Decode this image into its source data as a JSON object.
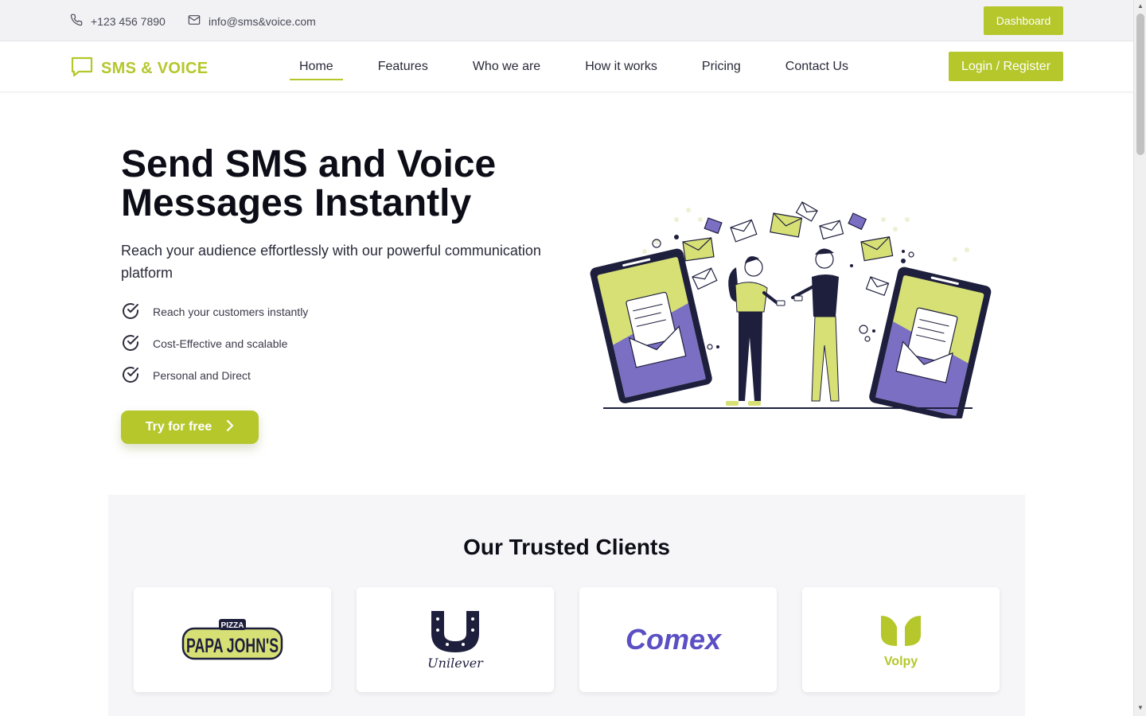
{
  "topbar": {
    "phone": "+123 456 7890",
    "email": "info@sms&voice.com",
    "dashboard_label": "Dashboard"
  },
  "nav": {
    "brand": "SMS & VOICE",
    "links": [
      "Home",
      "Features",
      "Who we are",
      "How it works",
      "Pricing",
      "Contact Us"
    ],
    "active": "Home",
    "login_label": "Login / Register"
  },
  "hero": {
    "title_line1": "Send SMS and Voice",
    "title_line2": "Messages Instantly",
    "subtitle": "Reach your audience effortlessly with our powerful communication platform",
    "features": [
      "Reach your customers instantly",
      "Cost-Effective and scalable",
      "Personal and Direct"
    ],
    "cta_label": "Try for free"
  },
  "clients": {
    "title": "Our Trusted Clients",
    "logos": [
      "PAPA JOHN'S",
      "Unilever",
      "Comex",
      "Volpy"
    ],
    "papa_small": "PIZZA"
  },
  "colors": {
    "accent": "#b5c72b",
    "purple": "#7b6fc4",
    "dark": "#1e1f3d"
  }
}
